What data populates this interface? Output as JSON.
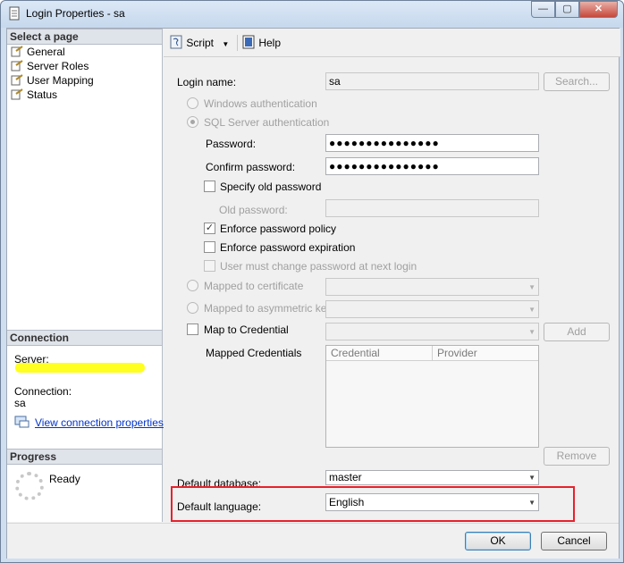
{
  "window": {
    "title": "Login Properties - sa",
    "controls": {
      "minimize": "—",
      "maximize": "▢",
      "close": "✕"
    }
  },
  "left_pane": {
    "select_page_header": "Select a page",
    "pages": [
      {
        "label": "General"
      },
      {
        "label": "Server Roles"
      },
      {
        "label": "User Mapping"
      },
      {
        "label": "Status"
      }
    ],
    "connection_header": "Connection",
    "server_label": "Server:",
    "connection_label": "Connection:",
    "connection_value": "sa",
    "view_connection_link": "View connection properties",
    "progress_header": "Progress",
    "progress_status": "Ready"
  },
  "toolbar": {
    "script_label": "Script",
    "help_label": "Help"
  },
  "form": {
    "login_name_label": "Login name:",
    "login_name_value": "sa",
    "search_button": "Search...",
    "windows_auth_label": "Windows authentication",
    "sql_auth_label": "SQL Server authentication",
    "password_label": "Password:",
    "password_value": "●●●●●●●●●●●●●●●",
    "confirm_password_label": "Confirm password:",
    "confirm_password_value": "●●●●●●●●●●●●●●●",
    "specify_old_password_label": "Specify old password",
    "old_password_label": "Old password:",
    "enforce_policy_label": "Enforce password policy",
    "enforce_policy_checked": "✓",
    "enforce_expiration_label": "Enforce password expiration",
    "must_change_label": "User must change password at next login",
    "mapped_cert_label": "Mapped to certificate",
    "mapped_asym_label": "Mapped to asymmetric key",
    "map_credential_label": "Map to Credential",
    "add_button": "Add",
    "mapped_credentials_label": "Mapped Credentials",
    "grid_columns": [
      "Credential",
      "Provider"
    ],
    "remove_button": "Remove",
    "default_database_label": "Default database:",
    "default_database_value": "master",
    "default_language_label": "Default language:",
    "default_language_value": "English"
  },
  "footer": {
    "ok_button": "OK",
    "cancel_button": "Cancel"
  },
  "colors": {
    "highlight_box": "#e8212d",
    "link": "#0033cc",
    "redaction": "#ffff20"
  }
}
